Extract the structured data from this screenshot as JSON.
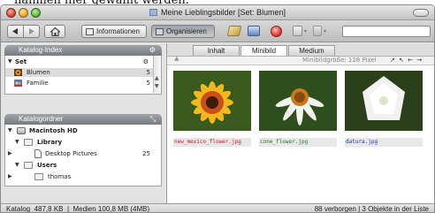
{
  "clipped_heading": "nahmen hier gewählt werden.",
  "window": {
    "title": "Meine Lieblingsbilder [Set: Blumen]"
  },
  "toolbar": {
    "back_icon": "back-arrow-icon",
    "forward_icon": "forward-arrow-icon",
    "home_icon": "home-icon",
    "informationen_label": "Informationen",
    "organisieren_label": "Organisieren"
  },
  "catalog_index": {
    "title": "Katalog-Index",
    "set_label": "Set",
    "items": [
      {
        "label": "Blumen",
        "count": "5"
      },
      {
        "label": "Familie",
        "count": "5"
      }
    ]
  },
  "catalog_folders": {
    "title": "Katalogordner",
    "items": [
      {
        "label": "Macintosh HD",
        "count": ""
      },
      {
        "label": "Library",
        "count": ""
      },
      {
        "label": "Desktop Pictures",
        "count": "25"
      },
      {
        "label": "Users",
        "count": ""
      },
      {
        "label": "thomas",
        "count": ""
      }
    ]
  },
  "tabs": [
    {
      "label": "Inhalt",
      "active": false
    },
    {
      "label": "Minibild",
      "active": true
    },
    {
      "label": "Medium",
      "active": false
    }
  ],
  "subbar": {
    "sort_glyph": "≜",
    "size_label": "Minibildgröße: 128 Pixel",
    "arrows": "↗ ↖ ← →"
  },
  "thumbnails": [
    {
      "filename": "new_mexico_flower.jpg",
      "color": "#c8102e"
    },
    {
      "filename": "cone_flower.jpg",
      "color": "#1a7a1a"
    },
    {
      "filename": "datura.jpg",
      "color": "#1f2fa8"
    }
  ],
  "status": {
    "left": "Katalog  487,8 KB  |  Medien 100,8 MB (4MB)",
    "right": "88 verborgen  |  3 Objekte in der Liste"
  }
}
